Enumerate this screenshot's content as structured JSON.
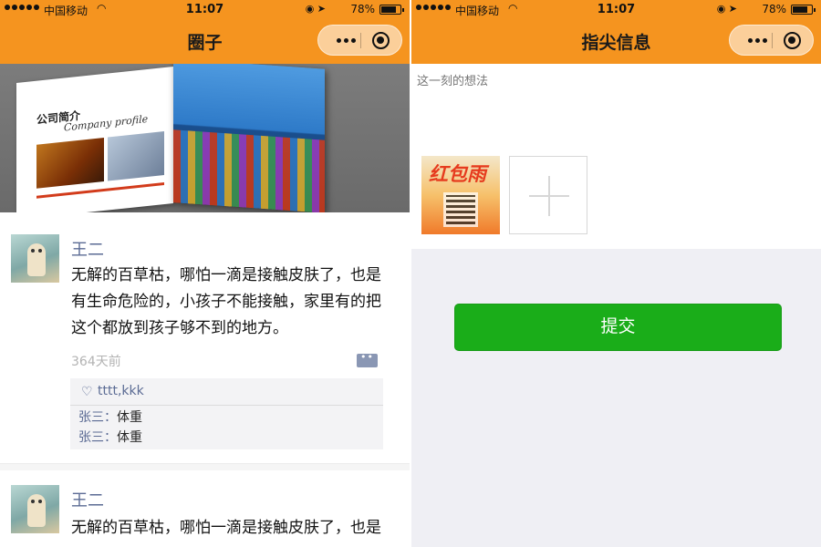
{
  "status_bar": {
    "carrier": "中国移动",
    "time": "11:07",
    "battery_pct": "78%",
    "battery_level": 0.78
  },
  "left": {
    "title": "圈子",
    "banner": {
      "heading": "公司简介",
      "subheading": "Company profile",
      "slide_count": 3,
      "active_slide": 1
    },
    "posts": [
      {
        "user": "王二",
        "content": "无解的百草枯，哪怕一滴是接触皮肤了，也是有生命危险的，小孩子不能接触，家里有的把这个都放到孩子够不到的地方。",
        "time_ago": "364天前",
        "likes": "tttt,kkk",
        "comments": [
          {
            "user": "张三",
            "text": "体重"
          },
          {
            "user": "张三",
            "text": "体重"
          }
        ]
      },
      {
        "user": "王二",
        "content": "无解的百草枯，哪怕一滴是接触皮肤了，也是"
      }
    ]
  },
  "right": {
    "title": "指尖信息",
    "placeholder": "这一刻的想法",
    "thumb_text": "红包雨",
    "submit_label": "提交"
  },
  "colors": {
    "nav_bg": "#f5941f",
    "link": "#5b6b94",
    "submit": "#1aad19",
    "page_bg": "#efeff4"
  },
  "icons": [
    "wifi-icon",
    "location-icon",
    "battery-icon",
    "more-icon",
    "close-circle-icon",
    "heart-icon",
    "comment-icon",
    "plus-icon"
  ]
}
